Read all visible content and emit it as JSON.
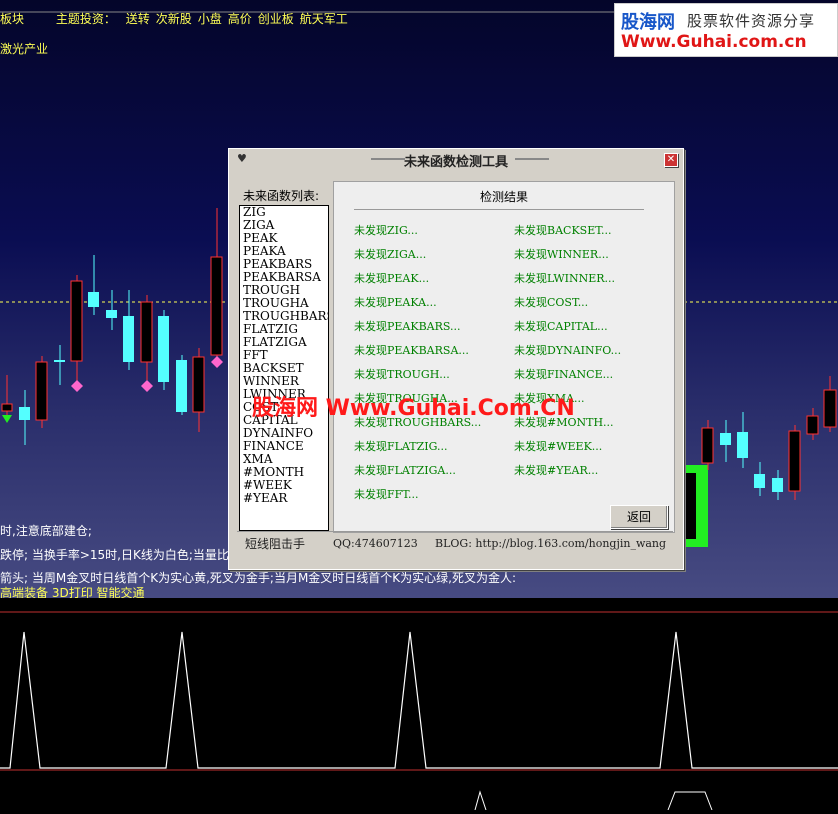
{
  "header": {
    "block_label": "板块",
    "theme_label": "主题投资：",
    "themes": [
      "送转",
      "次新股",
      "小盘",
      "高价",
      "创业板",
      "航天军工"
    ],
    "sub_label": "激光产业"
  },
  "logo": {
    "name": "股海网",
    "slogan": "股票软件资源分享",
    "url": "Www.Guhai.com.cn"
  },
  "info_lines": [
    "时,注意底部建仓;",
    "跌停; 当换手率>15时,日K线为白色;当量比>",
    "箭头; 当周M金叉时日线首个K为实心黄,死叉为金手;当月M金叉时日线首个K为实心绿,死叉为金人:"
  ],
  "sector_line": "高端装备  3D打印  智能交通",
  "watermark": "股海网 Www.Guhai.Com.CN",
  "dialog": {
    "title": "未来函数检测工具",
    "list_label": "未来函数列表:",
    "functions": [
      "ZIG",
      "ZIGA",
      "PEAK",
      "PEAKA",
      "PEAKBARS",
      "PEAKBARSA",
      "TROUGH",
      "TROUGHA",
      "TROUGHBARS",
      "FLATZIG",
      "FLATZIGA",
      "FFT",
      "BACKSET",
      "WINNER",
      "LWINNER",
      "COST",
      "CAPITAL",
      "DYNAINFO",
      "FINANCE",
      "XMA",
      "#MONTH",
      "#WEEK",
      "#YEAR"
    ],
    "results_title": "检测结果",
    "results_left": [
      "未发现ZIG...",
      "未发现ZIGA...",
      "未发现PEAK...",
      "未发现PEAKA...",
      "未发现PEAKBARS...",
      "未发现PEAKBARSA...",
      "未发现TROUGH...",
      "未发现TROUGHA...",
      "未发现TROUGHBARS...",
      "未发现FLATZIG...",
      "未发现FLATZIGA...",
      "未发现FFT..."
    ],
    "results_right": [
      "未发现BACKSET...",
      "未发现WINNER...",
      "未发现LWINNER...",
      "未发现COST...",
      "未发现CAPITAL...",
      "未发现DYNAINFO...",
      "未发现FINANCE...",
      "未发现XMA...",
      "未发现#MONTH...",
      "未发现#WEEK...",
      "未发现#YEAR..."
    ],
    "back_button": "返回",
    "footer_left": "短线阻击手",
    "footer_qq": "QQ:474607123",
    "footer_blog": "BLOG: http://blog.163.com/hongjin_wang"
  },
  "colors": {
    "up": "#ff3232",
    "down": "#54ffff",
    "highlight": "#22ee22",
    "dash_line": "#ffff55"
  }
}
